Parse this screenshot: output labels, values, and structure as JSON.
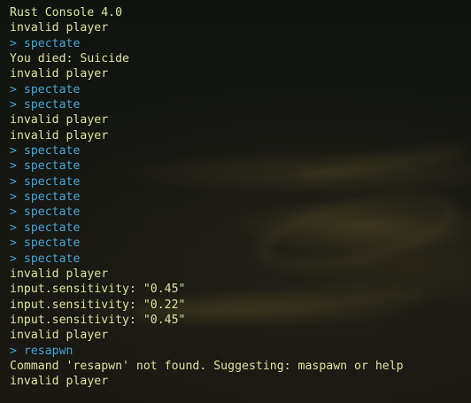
{
  "console": {
    "lines": [
      {
        "type": "output",
        "text": "Rust Console 4.0"
      },
      {
        "type": "output",
        "text": "invalid player"
      },
      {
        "type": "command",
        "text": "> spectate"
      },
      {
        "type": "output",
        "text": "You died: Suicide"
      },
      {
        "type": "output",
        "text": "invalid player"
      },
      {
        "type": "command",
        "text": "> spectate"
      },
      {
        "type": "command",
        "text": "> spectate"
      },
      {
        "type": "output",
        "text": "invalid player"
      },
      {
        "type": "output",
        "text": "invalid player"
      },
      {
        "type": "command",
        "text": "> spectate"
      },
      {
        "type": "command",
        "text": "> spectate"
      },
      {
        "type": "command",
        "text": "> spectate"
      },
      {
        "type": "command",
        "text": "> spectate"
      },
      {
        "type": "command",
        "text": "> spectate"
      },
      {
        "type": "command",
        "text": "> spectate"
      },
      {
        "type": "command",
        "text": "> spectate"
      },
      {
        "type": "command",
        "text": "> spectate"
      },
      {
        "type": "output",
        "text": "invalid player"
      },
      {
        "type": "output",
        "text": "input.sensitivity: \"0.45\""
      },
      {
        "type": "output",
        "text": "input.sensitivity: \"0.22\""
      },
      {
        "type": "output",
        "text": "input.sensitivity: \"0.45\""
      },
      {
        "type": "output",
        "text": "invalid player"
      },
      {
        "type": "command",
        "text": "> resapwn"
      },
      {
        "type": "output",
        "text": "Command 'resapwn' not found. Suggesting: maspawn or help"
      },
      {
        "type": "output",
        "text": "invalid player"
      }
    ]
  },
  "colors": {
    "output_text": "#dfe8a6",
    "command_text": "#4aa8d8",
    "background": "#141511"
  }
}
